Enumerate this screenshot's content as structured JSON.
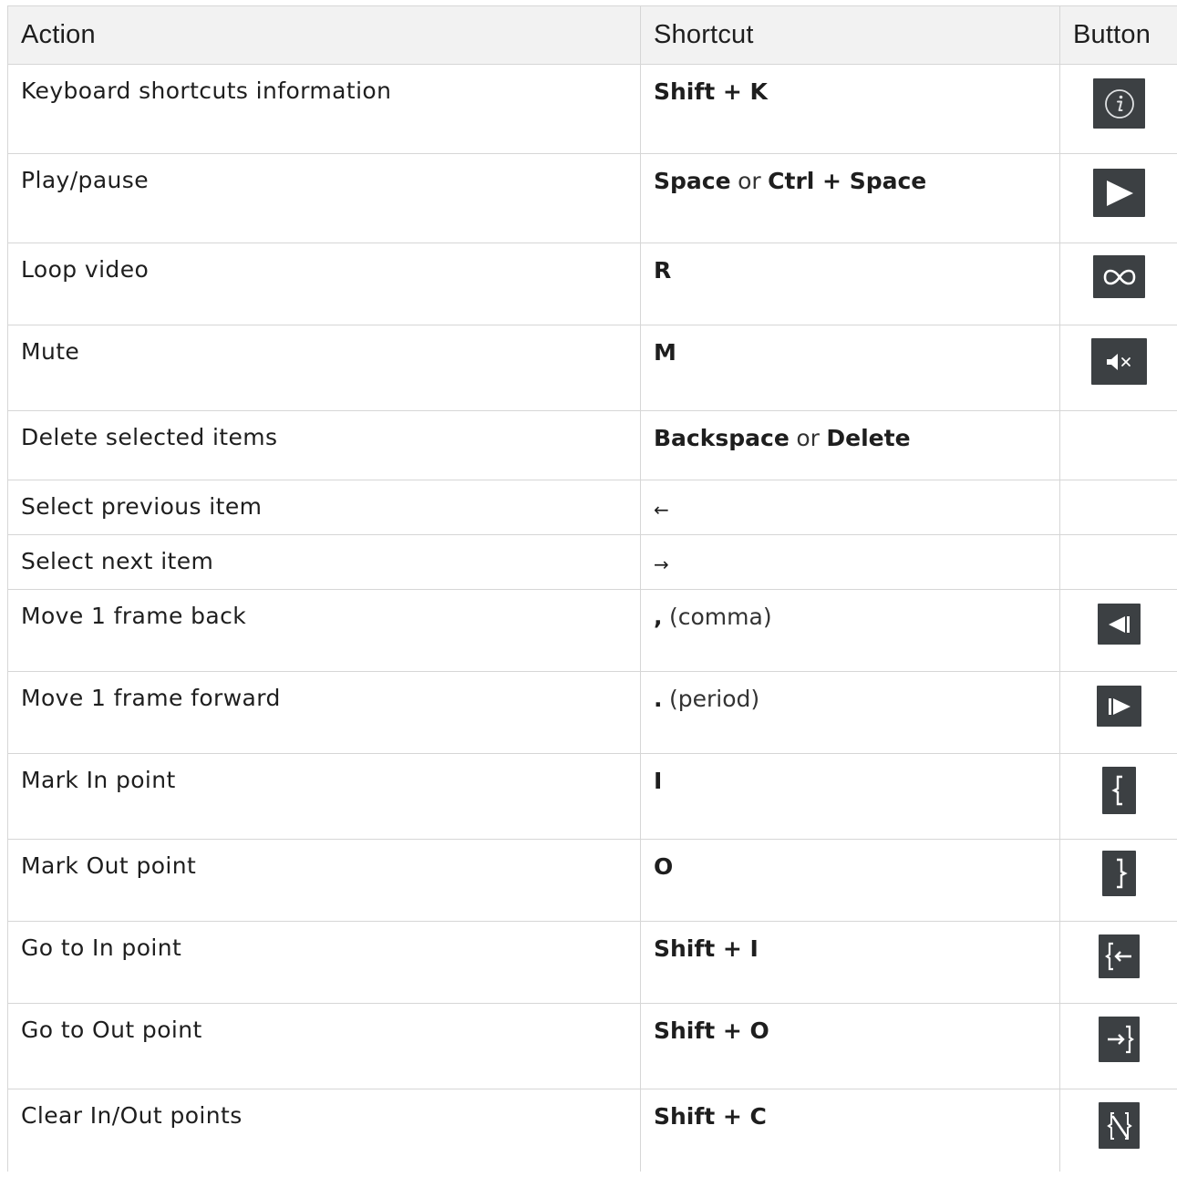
{
  "headers": {
    "action": "Action",
    "shortcut": "Shortcut",
    "button": "Button"
  },
  "rows": [
    {
      "action": "Keyboard shortcuts information",
      "keys": [
        "Shift + K"
      ],
      "connector": "",
      "icon": "info-icon"
    },
    {
      "action": "Play/pause",
      "keys": [
        "Space",
        "Ctrl + Space"
      ],
      "connector": "or",
      "icon": "play-icon"
    },
    {
      "action": "Loop video",
      "keys": [
        "R"
      ],
      "connector": "",
      "icon": "loop-icon"
    },
    {
      "action": "Mute",
      "keys": [
        "M"
      ],
      "connector": "",
      "icon": "mute-icon"
    },
    {
      "action": "Delete selected items",
      "keys": [
        "Backspace",
        "Delete"
      ],
      "connector": "or",
      "icon": ""
    },
    {
      "action": "Select previous item",
      "keys": [
        "←"
      ],
      "connector": "",
      "icon": ""
    },
    {
      "action": "Select next item",
      "keys": [
        "→"
      ],
      "connector": "",
      "icon": ""
    },
    {
      "action": "Move 1 frame back",
      "keys": [
        ","
      ],
      "suffix": "(comma)",
      "connector": "",
      "icon": "frame-back-icon"
    },
    {
      "action": "Move 1 frame forward",
      "keys": [
        "."
      ],
      "suffix": "(period)",
      "connector": "",
      "icon": "frame-forward-icon"
    },
    {
      "action": "Mark In point",
      "keys": [
        "I"
      ],
      "connector": "",
      "icon": "mark-in-icon"
    },
    {
      "action": "Mark Out point",
      "keys": [
        "O"
      ],
      "connector": "",
      "icon": "mark-out-icon"
    },
    {
      "action": "Go to In point",
      "keys": [
        "Shift + I"
      ],
      "connector": "",
      "icon": "go-to-in-icon"
    },
    {
      "action": "Go to Out point",
      "keys": [
        "Shift + O"
      ],
      "connector": "",
      "icon": "go-to-out-icon"
    },
    {
      "action": "Clear In/Out points",
      "keys": [
        "Shift + C"
      ],
      "connector": "",
      "icon": "clear-in-out-icon"
    }
  ],
  "colors": {
    "header_bg": "#f2f2f2",
    "border": "#d6d6d6",
    "button_bg": "#3c4043",
    "icon_fg": "#ffffff"
  }
}
